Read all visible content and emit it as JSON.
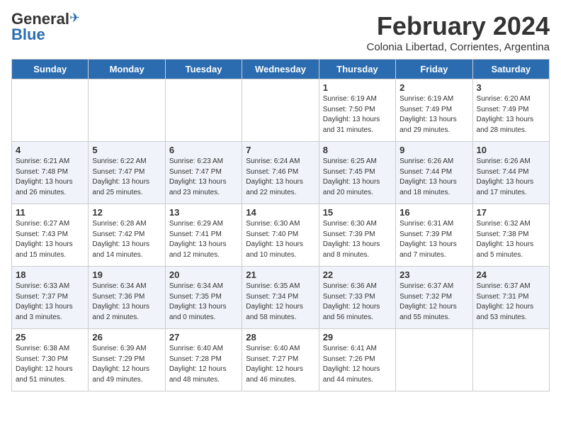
{
  "logo": {
    "general": "General",
    "blue": "Blue"
  },
  "title": "February 2024",
  "subtitle": "Colonia Libertad, Corrientes, Argentina",
  "days_of_week": [
    "Sunday",
    "Monday",
    "Tuesday",
    "Wednesday",
    "Thursday",
    "Friday",
    "Saturday"
  ],
  "weeks": [
    [
      {
        "day": "",
        "info": ""
      },
      {
        "day": "",
        "info": ""
      },
      {
        "day": "",
        "info": ""
      },
      {
        "day": "",
        "info": ""
      },
      {
        "day": "1",
        "info": "Sunrise: 6:19 AM\nSunset: 7:50 PM\nDaylight: 13 hours\nand 31 minutes."
      },
      {
        "day": "2",
        "info": "Sunrise: 6:19 AM\nSunset: 7:49 PM\nDaylight: 13 hours\nand 29 minutes."
      },
      {
        "day": "3",
        "info": "Sunrise: 6:20 AM\nSunset: 7:49 PM\nDaylight: 13 hours\nand 28 minutes."
      }
    ],
    [
      {
        "day": "4",
        "info": "Sunrise: 6:21 AM\nSunset: 7:48 PM\nDaylight: 13 hours\nand 26 minutes."
      },
      {
        "day": "5",
        "info": "Sunrise: 6:22 AM\nSunset: 7:47 PM\nDaylight: 13 hours\nand 25 minutes."
      },
      {
        "day": "6",
        "info": "Sunrise: 6:23 AM\nSunset: 7:47 PM\nDaylight: 13 hours\nand 23 minutes."
      },
      {
        "day": "7",
        "info": "Sunrise: 6:24 AM\nSunset: 7:46 PM\nDaylight: 13 hours\nand 22 minutes."
      },
      {
        "day": "8",
        "info": "Sunrise: 6:25 AM\nSunset: 7:45 PM\nDaylight: 13 hours\nand 20 minutes."
      },
      {
        "day": "9",
        "info": "Sunrise: 6:26 AM\nSunset: 7:44 PM\nDaylight: 13 hours\nand 18 minutes."
      },
      {
        "day": "10",
        "info": "Sunrise: 6:26 AM\nSunset: 7:44 PM\nDaylight: 13 hours\nand 17 minutes."
      }
    ],
    [
      {
        "day": "11",
        "info": "Sunrise: 6:27 AM\nSunset: 7:43 PM\nDaylight: 13 hours\nand 15 minutes."
      },
      {
        "day": "12",
        "info": "Sunrise: 6:28 AM\nSunset: 7:42 PM\nDaylight: 13 hours\nand 14 minutes."
      },
      {
        "day": "13",
        "info": "Sunrise: 6:29 AM\nSunset: 7:41 PM\nDaylight: 13 hours\nand 12 minutes."
      },
      {
        "day": "14",
        "info": "Sunrise: 6:30 AM\nSunset: 7:40 PM\nDaylight: 13 hours\nand 10 minutes."
      },
      {
        "day": "15",
        "info": "Sunrise: 6:30 AM\nSunset: 7:39 PM\nDaylight: 13 hours\nand 8 minutes."
      },
      {
        "day": "16",
        "info": "Sunrise: 6:31 AM\nSunset: 7:39 PM\nDaylight: 13 hours\nand 7 minutes."
      },
      {
        "day": "17",
        "info": "Sunrise: 6:32 AM\nSunset: 7:38 PM\nDaylight: 13 hours\nand 5 minutes."
      }
    ],
    [
      {
        "day": "18",
        "info": "Sunrise: 6:33 AM\nSunset: 7:37 PM\nDaylight: 13 hours\nand 3 minutes."
      },
      {
        "day": "19",
        "info": "Sunrise: 6:34 AM\nSunset: 7:36 PM\nDaylight: 13 hours\nand 2 minutes."
      },
      {
        "day": "20",
        "info": "Sunrise: 6:34 AM\nSunset: 7:35 PM\nDaylight: 13 hours\nand 0 minutes."
      },
      {
        "day": "21",
        "info": "Sunrise: 6:35 AM\nSunset: 7:34 PM\nDaylight: 12 hours\nand 58 minutes."
      },
      {
        "day": "22",
        "info": "Sunrise: 6:36 AM\nSunset: 7:33 PM\nDaylight: 12 hours\nand 56 minutes."
      },
      {
        "day": "23",
        "info": "Sunrise: 6:37 AM\nSunset: 7:32 PM\nDaylight: 12 hours\nand 55 minutes."
      },
      {
        "day": "24",
        "info": "Sunrise: 6:37 AM\nSunset: 7:31 PM\nDaylight: 12 hours\nand 53 minutes."
      }
    ],
    [
      {
        "day": "25",
        "info": "Sunrise: 6:38 AM\nSunset: 7:30 PM\nDaylight: 12 hours\nand 51 minutes."
      },
      {
        "day": "26",
        "info": "Sunrise: 6:39 AM\nSunset: 7:29 PM\nDaylight: 12 hours\nand 49 minutes."
      },
      {
        "day": "27",
        "info": "Sunrise: 6:40 AM\nSunset: 7:28 PM\nDaylight: 12 hours\nand 48 minutes."
      },
      {
        "day": "28",
        "info": "Sunrise: 6:40 AM\nSunset: 7:27 PM\nDaylight: 12 hours\nand 46 minutes."
      },
      {
        "day": "29",
        "info": "Sunrise: 6:41 AM\nSunset: 7:26 PM\nDaylight: 12 hours\nand 44 minutes."
      },
      {
        "day": "",
        "info": ""
      },
      {
        "day": "",
        "info": ""
      }
    ]
  ]
}
